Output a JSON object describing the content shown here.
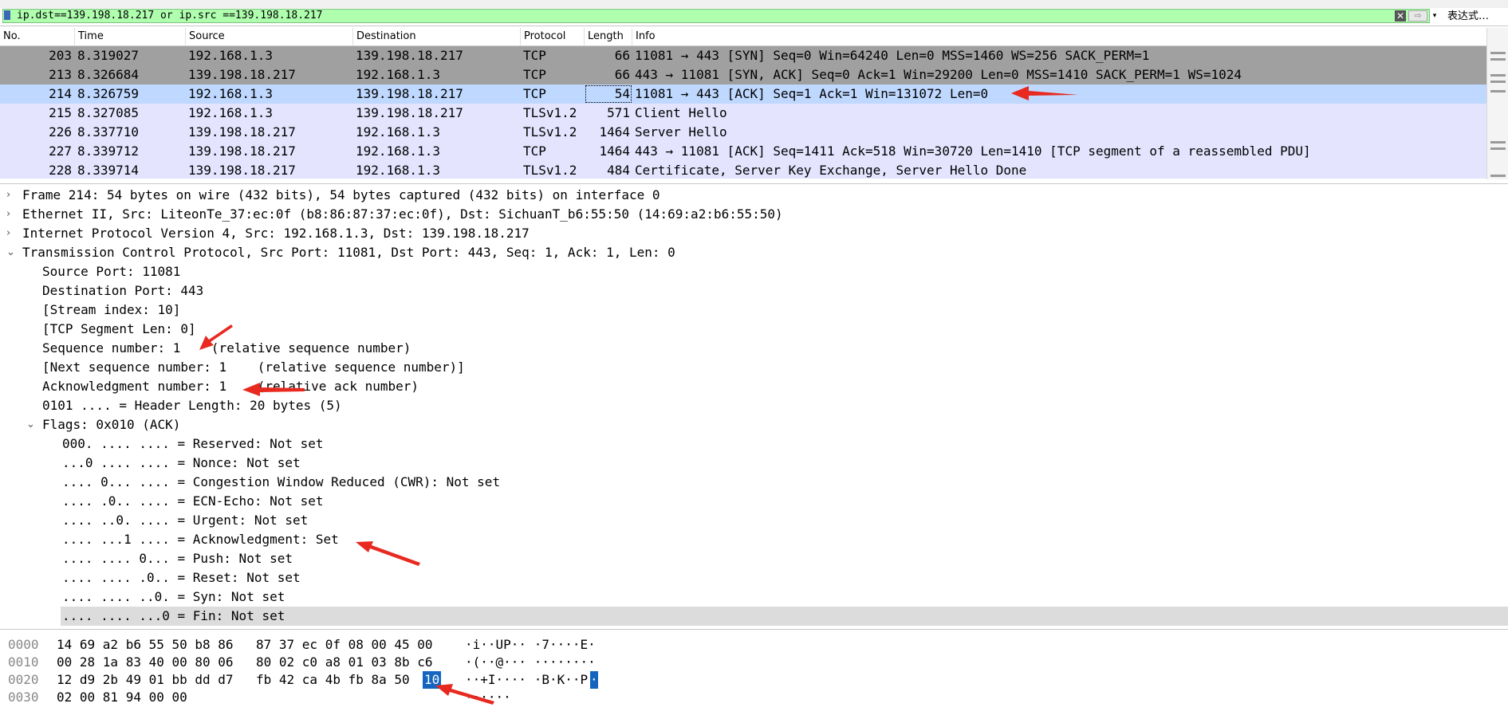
{
  "filter": {
    "value": "ip.dst==139.198.18.217 or ip.src ==139.198.18.217",
    "clear_glyph": "✕",
    "apply_glyph": "⇨",
    "dropdown_glyph": "▾",
    "expression_label": "表达式…"
  },
  "packet_list": {
    "columns": [
      "No.",
      "Time",
      "Source",
      "Destination",
      "Protocol",
      "Length",
      "Info"
    ],
    "rows": [
      {
        "no": "203",
        "time": "8.319027",
        "src": "192.168.1.3",
        "dst": "139.198.18.217",
        "proto": "TCP",
        "len": "66",
        "info": "11081 → 443 [SYN] Seq=0 Win=64240 Len=0 MSS=1460 WS=256 SACK_PERM=1",
        "bg": "#a0a0a0"
      },
      {
        "no": "213",
        "time": "8.326684",
        "src": "139.198.18.217",
        "dst": "192.168.1.3",
        "proto": "TCP",
        "len": "66",
        "info": "443 → 11081 [SYN, ACK] Seq=0 Ack=1 Win=29200 Len=0 MSS=1410 SACK_PERM=1 WS=1024",
        "bg": "#a0a0a0"
      },
      {
        "no": "214",
        "time": "8.326759",
        "src": "192.168.1.3",
        "dst": "139.198.18.217",
        "proto": "TCP",
        "len": "54",
        "info": "11081 → 443 [ACK] Seq=1 Ack=1 Win=131072 Len=0",
        "bg": "#bfd8ff"
      },
      {
        "no": "215",
        "time": "8.327085",
        "src": "192.168.1.3",
        "dst": "139.198.18.217",
        "proto": "TLSv1.2",
        "len": "571",
        "info": "Client Hello",
        "bg": "#e4e4ff"
      },
      {
        "no": "226",
        "time": "8.337710",
        "src": "139.198.18.217",
        "dst": "192.168.1.3",
        "proto": "TLSv1.2",
        "len": "1464",
        "info": "Server Hello",
        "bg": "#e4e4ff"
      },
      {
        "no": "227",
        "time": "8.339712",
        "src": "139.198.18.217",
        "dst": "192.168.1.3",
        "proto": "TCP",
        "len": "1464",
        "info": "443 → 11081 [ACK] Seq=1411 Ack=518 Win=30720 Len=1410 [TCP segment of a reassembled PDU]",
        "bg": "#e4e4ff"
      },
      {
        "no": "228",
        "time": "8.339714",
        "src": "139.198.18.217",
        "dst": "192.168.1.3",
        "proto": "TLSv1.2",
        "len": "484",
        "info": "Certificate, Server Key Exchange, Server Hello Done",
        "bg": "#e4e4ff"
      }
    ]
  },
  "detail": {
    "frame": "Frame 214: 54 bytes on wire (432 bits), 54 bytes captured (432 bits) on interface 0",
    "ethernet": "Ethernet II, Src: LiteonTe_37:ec:0f (b8:86:87:37:ec:0f), Dst: SichuanT_b6:55:50 (14:69:a2:b6:55:50)",
    "ip": "Internet Protocol Version 4, Src: 192.168.1.3, Dst: 139.198.18.217",
    "tcp": "Transmission Control Protocol, Src Port: 11081, Dst Port: 443, Seq: 1, Ack: 1, Len: 0",
    "tcp_fields": [
      "Source Port: 11081",
      "Destination Port: 443",
      "[Stream index: 10]",
      "[TCP Segment Len: 0]",
      "Sequence number: 1    (relative sequence number)",
      "[Next sequence number: 1    (relative sequence number)]",
      "Acknowledgment number: 1    (relative ack number)",
      "0101 .... = Header Length: 20 bytes (5)"
    ],
    "flags_header": "Flags: 0x010 (ACK)",
    "flags": [
      "000. .... .... = Reserved: Not set",
      "...0 .... .... = Nonce: Not set",
      ".... 0... .... = Congestion Window Reduced (CWR): Not set",
      ".... .0.. .... = ECN-Echo: Not set",
      ".... ..0. .... = Urgent: Not set",
      ".... ...1 .... = Acknowledgment: Set",
      ".... .... 0... = Push: Not set",
      ".... .... .0.. = Reset: Not set",
      ".... .... ..0. = Syn: Not set",
      ".... .... ...0 = Fin: Not set"
    ],
    "collapsed_glyph": "›",
    "expanded_glyph": "⌄"
  },
  "bytes": {
    "rows": [
      {
        "offset": "0000",
        "hex_a": "14 69 a2 b6 55 50 b8 86",
        "hex_b": "87 37 ec 0f 08 00 45 00",
        "hex_b_hl": "",
        "ascii": "·i··UP·· ·7····E·",
        "ascii_hl": ""
      },
      {
        "offset": "0010",
        "hex_a": "00 28 1a 83 40 00 80 06",
        "hex_b": "80 02 c0 a8 01 03 8b c6",
        "hex_b_hl": "",
        "ascii": "·(··@··· ········",
        "ascii_hl": ""
      },
      {
        "offset": "0020",
        "hex_a": "12 d9 2b 49 01 bb dd d7",
        "hex_b": "fb 42 ca 4b fb 8a 50",
        "hex_b_hl": "10",
        "ascii": "··+I···· ·B·K··P",
        "ascii_hl": "·"
      },
      {
        "offset": "0030",
        "hex_a": "02 00 81 94 00 00",
        "hex_b": "",
        "hex_b_hl": "",
        "ascii": "······",
        "ascii_hl": ""
      }
    ]
  },
  "colors": {
    "filter_ok": "#afffaf",
    "tcp_syn_row": "#a0a0a0",
    "selected_row": "#bfd8ff",
    "tls_row": "#e4e4ff",
    "byte_highlight": "#1565c0",
    "annotation_arrow": "#e8291f"
  }
}
